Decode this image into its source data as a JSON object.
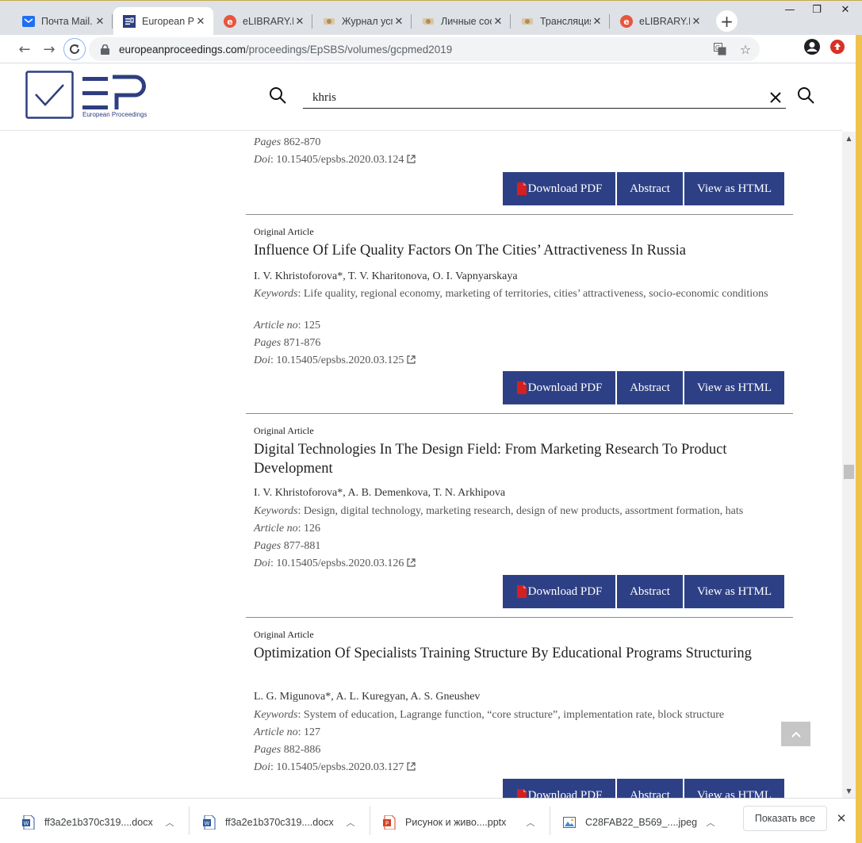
{
  "browser": {
    "tabs": [
      {
        "title": "Почта Mail.",
        "icon": "mail-icon",
        "active": false
      },
      {
        "title": "European P",
        "icon": "ep-icon",
        "active": true
      },
      {
        "title": "eLIBRARY.R",
        "icon": "elibrary-icon",
        "active": false
      },
      {
        "title": "Журнал усп",
        "icon": "site-icon",
        "active": false
      },
      {
        "title": "Личные соо",
        "icon": "site-icon",
        "active": false
      },
      {
        "title": "Трансляция",
        "icon": "site-icon",
        "active": false
      },
      {
        "title": "eLIBRARY.R",
        "icon": "elibrary-icon",
        "active": false
      }
    ],
    "url_host": "europeanproceedings.com",
    "url_path": "/proceedings/EpSBS/volumes/gcpmed2019"
  },
  "site": {
    "logo_text": "European Proceedings",
    "search_value": "khris"
  },
  "top_partial": {
    "pages_label": "Pages",
    "pages": "862-870",
    "doi_label": "Doi",
    "doi": "10.15405/epsbs.2020.03.124"
  },
  "labels": {
    "article_type": "Original Article",
    "keywords": "Keywords",
    "article_no": "Article no",
    "pages": "Pages",
    "doi": "Doi",
    "download_pdf": "Download PDF",
    "abstract": "Abstract",
    "view_html": "View as HTML"
  },
  "articles": [
    {
      "title": "Influence Of Life Quality Factors On The Cities’ Attractiveness In Russia",
      "authors": "I. V. Khristoforova*, T. V. Kharitonova, O. I. Vapnyarskaya",
      "keywords": "Life quality, regional economy, marketing of territories, cities’ attractiveness, socio-economic conditions",
      "article_no": "125",
      "pages": "871-876",
      "doi": "10.15405/epsbs.2020.03.125"
    },
    {
      "title": "Digital Technologies In The Design Field: From Marketing Research To Product Development",
      "authors": "I. V. Khristoforova*, A. B. Demenkova, T. N. Arkhipova",
      "keywords": "Design, digital technology, marketing research, design of new products, assortment formation, hats",
      "article_no": "126",
      "pages": "877-881",
      "doi": "10.15405/epsbs.2020.03.126"
    },
    {
      "title": "Optimization Of Specialists Training Structure By Educational Programs Structuring",
      "authors": "L. G. Migunova*, A. L. Kuregyan, A. S. Gneushev",
      "keywords": "System of education, Lagrange function, “core structure”, implementation rate, block structure",
      "article_no": "127",
      "pages": "882-886",
      "doi": "10.15405/epsbs.2020.03.127"
    }
  ],
  "downloads": {
    "items": [
      {
        "name": "ff3a2e1b370c319....docx",
        "icon": "word-file-icon"
      },
      {
        "name": "ff3a2e1b370c319....docx",
        "icon": "word-file-icon"
      },
      {
        "name": "Рисунок и живо....pptx",
        "icon": "powerpoint-file-icon"
      },
      {
        "name": "C28FAB22_B569_....jpeg",
        "icon": "image-file-icon"
      }
    ],
    "show_all": "Показать все"
  },
  "colors": {
    "button_bg": "#2e4085",
    "brand": "#2e3e80",
    "window_frame": "#f0c24d"
  }
}
